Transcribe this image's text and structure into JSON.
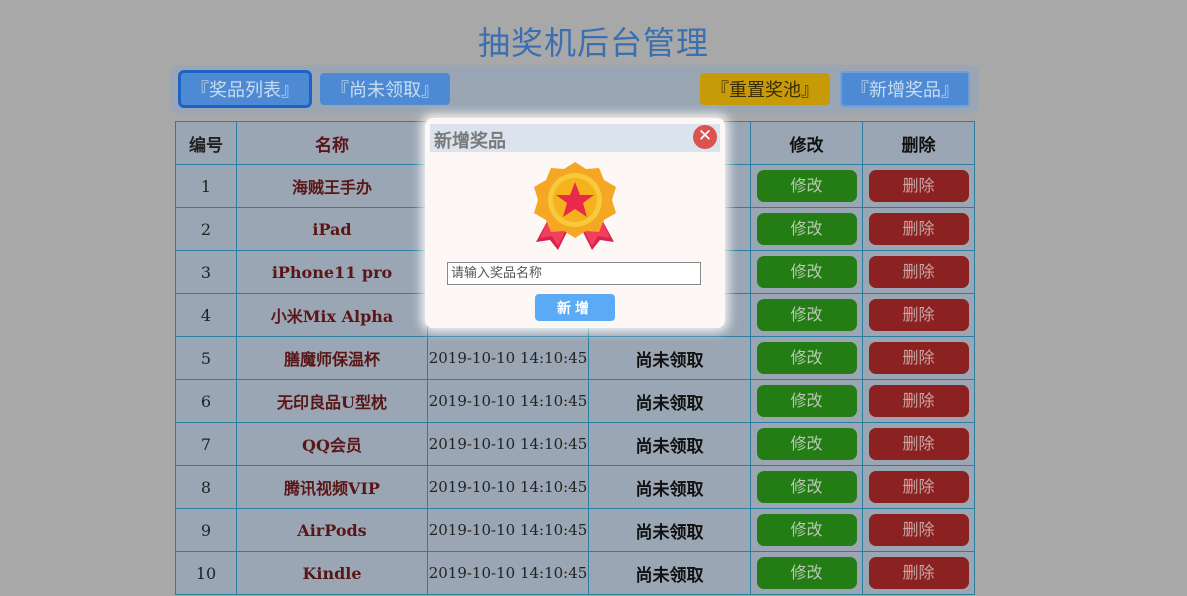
{
  "app": {
    "title": "抽奖机后台管理"
  },
  "toolbar": {
    "prize_list": "『奖品列表』",
    "unclaimed": "『尚未领取』",
    "reset_pool": "『重置奖池』",
    "add_prize": "『新增奖品』"
  },
  "table": {
    "headers": [
      "编号",
      "名称",
      "",
      "",
      "修改",
      "删除"
    ],
    "rows": [
      {
        "id": "1",
        "name": "海贼王手办",
        "time": "",
        "status": "",
        "edit": "修改",
        "delete": "删除"
      },
      {
        "id": "2",
        "name": "iPad",
        "time": "",
        "status": "",
        "edit": "修改",
        "delete": "删除"
      },
      {
        "id": "3",
        "name": "iPhone11 pro",
        "time": "",
        "status": "",
        "edit": "修改",
        "delete": "删除"
      },
      {
        "id": "4",
        "name": "小米Mix Alpha",
        "time": "",
        "status": "",
        "edit": "修改",
        "delete": "删除"
      },
      {
        "id": "5",
        "name": "膳魔师保温杯",
        "time": "2019-10-10 14:10:45",
        "status": "尚未领取",
        "edit": "修改",
        "delete": "删除"
      },
      {
        "id": "6",
        "name": "无印良品U型枕",
        "time": "2019-10-10 14:10:45",
        "status": "尚未领取",
        "edit": "修改",
        "delete": "删除"
      },
      {
        "id": "7",
        "name": "QQ会员",
        "time": "2019-10-10 14:10:45",
        "status": "尚未领取",
        "edit": "修改",
        "delete": "删除"
      },
      {
        "id": "8",
        "name": "腾讯视频VIP",
        "time": "2019-10-10 14:10:45",
        "status": "尚未领取",
        "edit": "修改",
        "delete": "删除"
      },
      {
        "id": "9",
        "name": "AirPods",
        "time": "2019-10-10 14:10:45",
        "status": "尚未领取",
        "edit": "修改",
        "delete": "删除"
      },
      {
        "id": "10",
        "name": "Kindle",
        "time": "2019-10-10 14:10:45",
        "status": "尚未领取",
        "edit": "修改",
        "delete": "删除"
      }
    ]
  },
  "modal": {
    "title": "新增奖品",
    "close_icon": "close-icon",
    "medal_icon": "medal-icon",
    "input_placeholder": "请输入奖品名称",
    "submit_label": "新增"
  }
}
